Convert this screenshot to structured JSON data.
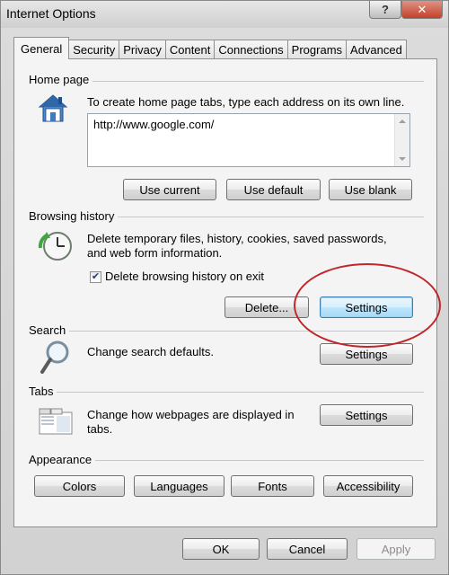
{
  "window": {
    "title": "Internet Options"
  },
  "tabs": [
    "General",
    "Security",
    "Privacy",
    "Content",
    "Connections",
    "Programs",
    "Advanced"
  ],
  "home_page": {
    "group_title": "Home page",
    "description": "To create home page tabs, type each address on its own line.",
    "url_value": "http://www.google.com/",
    "buttons": {
      "use_current": "Use current",
      "use_default": "Use default",
      "use_blank": "Use blank"
    }
  },
  "browsing_history": {
    "group_title": "Browsing history",
    "description_line1": "Delete temporary files, history, cookies, saved passwords,",
    "description_line2": "and web form information.",
    "checkbox_label": "Delete browsing history on exit",
    "checkbox_checked": true,
    "buttons": {
      "delete": "Delete...",
      "settings": "Settings"
    }
  },
  "search": {
    "group_title": "Search",
    "description": "Change search defaults.",
    "settings_label": "Settings"
  },
  "tabs_section": {
    "group_title": "Tabs",
    "description_line1": "Change how webpages are displayed in",
    "description_line2": "tabs.",
    "settings_label": "Settings"
  },
  "appearance": {
    "group_title": "Appearance",
    "buttons": {
      "colors": "Colors",
      "languages": "Languages",
      "fonts": "Fonts",
      "accessibility": "Accessibility"
    }
  },
  "footer": {
    "ok": "OK",
    "cancel": "Cancel",
    "apply": "Apply"
  },
  "title_buttons": {
    "help": "?",
    "close": "✕"
  },
  "colors": {
    "highlight_circle": "#c1262b",
    "focus_button": "#a7d9f5"
  }
}
